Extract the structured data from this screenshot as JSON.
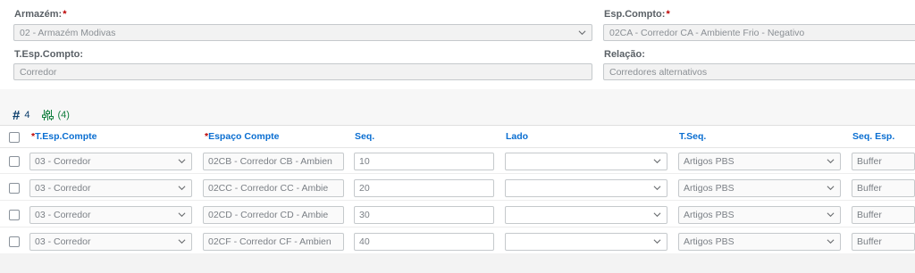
{
  "form": {
    "warehouse_label": "Armazém:",
    "warehouse_value": "02 - Armazém Modivas",
    "storage_label": "Esp.Compto:",
    "storage_value": "02CA - Corredor CA - Ambiente Frio - Negativo",
    "type_label": "T.Esp.Compto:",
    "type_value": "Corredor",
    "relation_label": "Relação:",
    "relation_value": "Corredores alternativos"
  },
  "toolbar": {
    "hash_symbol": "#",
    "row_count": "4",
    "filter_count": "(4)"
  },
  "table": {
    "headers": [
      "T.Esp.Compte",
      "Espaço Compte",
      "Seq.",
      "Lado",
      "T.Seq.",
      "Seq. Esp."
    ],
    "rows": [
      {
        "type": "03 - Corredor",
        "space": "02CB - Corredor CB -  Ambien",
        "seq": "10",
        "side": "",
        "tseq": "Artigos PBS",
        "seqesp": "Buffer"
      },
      {
        "type": "03 - Corredor",
        "space": "02CC - Corredor CC -  Ambie",
        "seq": "20",
        "side": "",
        "tseq": "Artigos PBS",
        "seqesp": "Buffer"
      },
      {
        "type": "03 - Corredor",
        "space": "02CD - Corredor CD -  Ambie",
        "seq": "30",
        "side": "",
        "tseq": "Artigos PBS",
        "seqesp": "Buffer"
      },
      {
        "type": "03 - Corredor",
        "space": "02CF - Corredor CF -  Ambien",
        "seq": "40",
        "side": "",
        "tseq": "Artigos PBS",
        "seqesp": "Buffer"
      }
    ]
  },
  "colors": {
    "header_link": "#0a6ed1",
    "required": "#bb0000",
    "filter": "#107e3e",
    "count": "#0a3d6b"
  }
}
